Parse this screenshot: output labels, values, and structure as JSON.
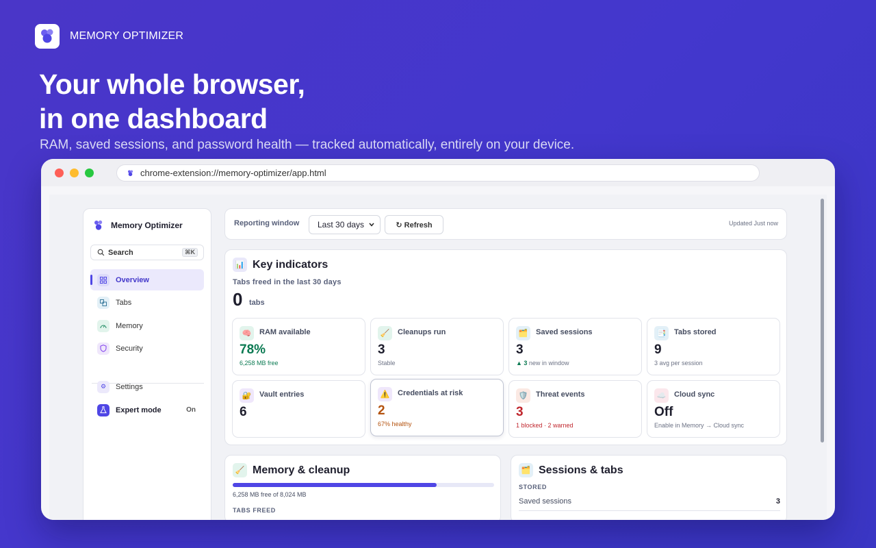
{
  "brand": {
    "name": "MEMORY OPTIMIZER"
  },
  "hero": {
    "title_line1": "Your whole browser,",
    "title_line2": "in one dashboard",
    "subtitle": "RAM, saved sessions, and password health — tracked automatically, entirely on your device."
  },
  "browser": {
    "url": "chrome-extension://memory-optimizer/app.html"
  },
  "sidebar": {
    "app_name": "Memory Optimizer",
    "search_label": "Search",
    "search_shortcut": "⌘K",
    "items": [
      {
        "label": "Overview",
        "icon": "grid-icon",
        "active": true
      },
      {
        "label": "Tabs",
        "icon": "tabs-icon"
      },
      {
        "label": "Memory",
        "icon": "gauge-icon"
      },
      {
        "label": "Security",
        "icon": "shield-icon"
      }
    ],
    "settings_label": "Settings",
    "expert_label": "Expert mode",
    "expert_state": "On"
  },
  "toolbar": {
    "reporting_label": "Reporting window",
    "window_value": "Last 30 days",
    "refresh_label": "↻ Refresh",
    "updated_text": "Updated Just now"
  },
  "key_indicators": {
    "title": "Key indicators",
    "freed_label": "Tabs freed in the last 30 days",
    "freed_value": "0",
    "freed_unit": "tabs",
    "tiles": [
      {
        "label": "RAM available",
        "value": "78%",
        "sub": "6,258 MB free",
        "icon": "brain-icon",
        "tone": "green"
      },
      {
        "label": "Cleanups run",
        "value": "3",
        "sub": "Stable",
        "icon": "broom-icon",
        "tone": "default"
      },
      {
        "label": "Saved sessions",
        "value": "3",
        "sub_arrow": "▲ 3",
        "sub": " new in window",
        "icon": "folder-icon",
        "tone": "default"
      },
      {
        "label": "Tabs stored",
        "value": "9",
        "sub": "3 avg per session",
        "icon": "document-icon",
        "tone": "default"
      },
      {
        "label": "Vault entries",
        "value": "6",
        "sub": "",
        "icon": "lock-icon",
        "tone": "default"
      },
      {
        "label": "Credentials at risk",
        "value": "2",
        "sub": "67% healthy",
        "icon": "warning-icon",
        "tone": "orange"
      },
      {
        "label": "Threat events",
        "value": "3",
        "sub": "1 blocked · 2 warned",
        "icon": "shield-icon",
        "tone": "red"
      },
      {
        "label": "Cloud sync",
        "value": "Off",
        "sub": "Enable in Memory → Cloud sync",
        "icon": "cloud-icon",
        "tone": "default"
      }
    ]
  },
  "memory_cleanup": {
    "title": "Memory & cleanup",
    "usage_text": "6,258 MB free of 8,024 MB",
    "free_fraction": 0.78,
    "section_label": "TABS FREED"
  },
  "sessions_tabs": {
    "title": "Sessions & tabs",
    "section_label": "STORED",
    "rows": [
      {
        "label": "Saved sessions",
        "value": "3"
      }
    ]
  },
  "colors": {
    "accent": "#4f46e5",
    "background": "#4337cd",
    "green": "#0b7a52",
    "orange": "#b4530f",
    "red": "#c0262d"
  }
}
